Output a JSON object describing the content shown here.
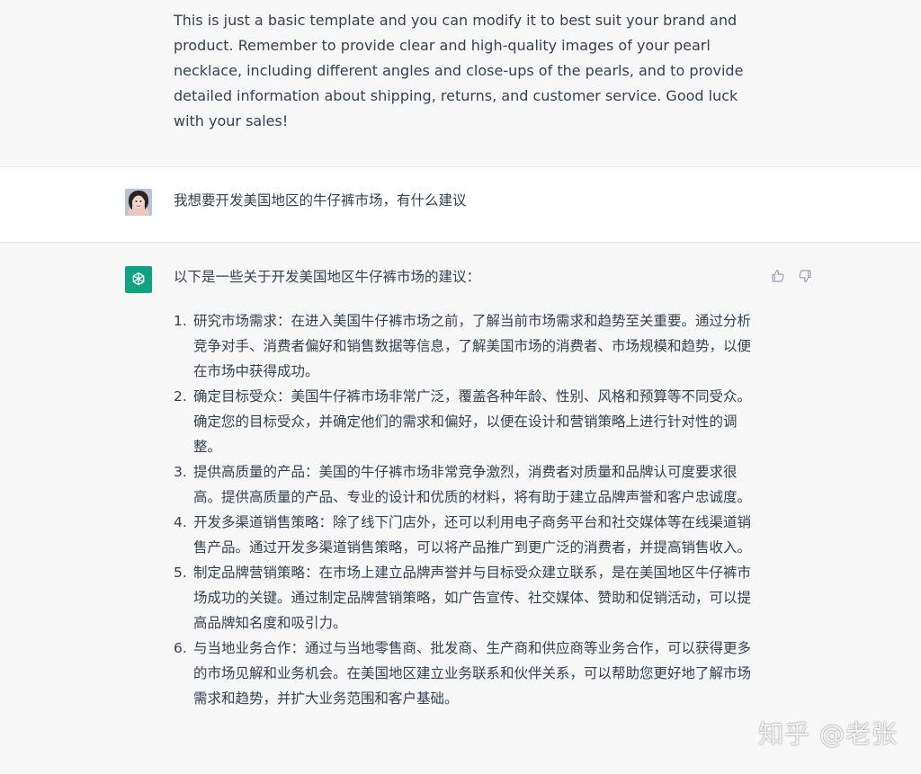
{
  "previous_assistant": {
    "text": "This is just a basic template and you can modify it to best suit your brand and product. Remember to provide clear and high-quality images of your pearl necklace, including different angles and close-ups of the pearls, and to provide detailed information about shipping, returns, and customer service. Good luck with your sales!"
  },
  "user_message": {
    "avatar_icon": "user-avatar-photo",
    "text": "我想要开发美国地区的牛仔裤市场，有什么建议"
  },
  "assistant_message": {
    "avatar_icon": "openai-logo",
    "intro": "以下是一些关于开发美国地区牛仔裤市场的建议：",
    "items": [
      {
        "num": "1.",
        "text": "研究市场需求：在进入美国牛仔裤市场之前，了解当前市场需求和趋势至关重要。通过分析竞争对手、消费者偏好和销售数据等信息，了解美国市场的消费者、市场规模和趋势，以便在市场中获得成功。"
      },
      {
        "num": "2.",
        "text": "确定目标受众：美国牛仔裤市场非常广泛，覆盖各种年龄、性别、风格和预算等不同受众。确定您的目标受众，并确定他们的需求和偏好，以便在设计和营销策略上进行针对性的调整。"
      },
      {
        "num": "3.",
        "text": "提供高质量的产品：美国的牛仔裤市场非常竞争激烈，消费者对质量和品牌认可度要求很高。提供高质量的产品、专业的设计和优质的材料，将有助于建立品牌声誉和客户忠诚度。"
      },
      {
        "num": "4.",
        "text": "开发多渠道销售策略：除了线下门店外，还可以利用电子商务平台和社交媒体等在线渠道销售产品。通过开发多渠道销售策略，可以将产品推广到更广泛的消费者，并提高销售收入。"
      },
      {
        "num": "5.",
        "text": "制定品牌营销策略：在市场上建立品牌声誉并与目标受众建立联系，是在美国地区牛仔裤市场成功的关键。通过制定品牌营销策略，如广告宣传、社交媒体、赞助和促销活动，可以提高品牌知名度和吸引力。"
      },
      {
        "num": "6.",
        "text": "与当地业务合作：通过与当地零售商、批发商、生产商和供应商等业务合作，可以获得更多的市场见解和业务机会。在美国地区建立业务联系和伙伴关系，可以帮助您更好地了解市场需求和趋势，并扩大业务范围和客户基础。"
      }
    ],
    "feedback": {
      "thumbs_up_icon": "thumbs-up-icon",
      "thumbs_down_icon": "thumbs-down-icon"
    }
  },
  "watermark": "知乎 @老张",
  "colors": {
    "assistant_bg": "#f7f7f8",
    "user_bg": "#ffffff",
    "brand_green": "#10a37f",
    "text": "#374151"
  }
}
